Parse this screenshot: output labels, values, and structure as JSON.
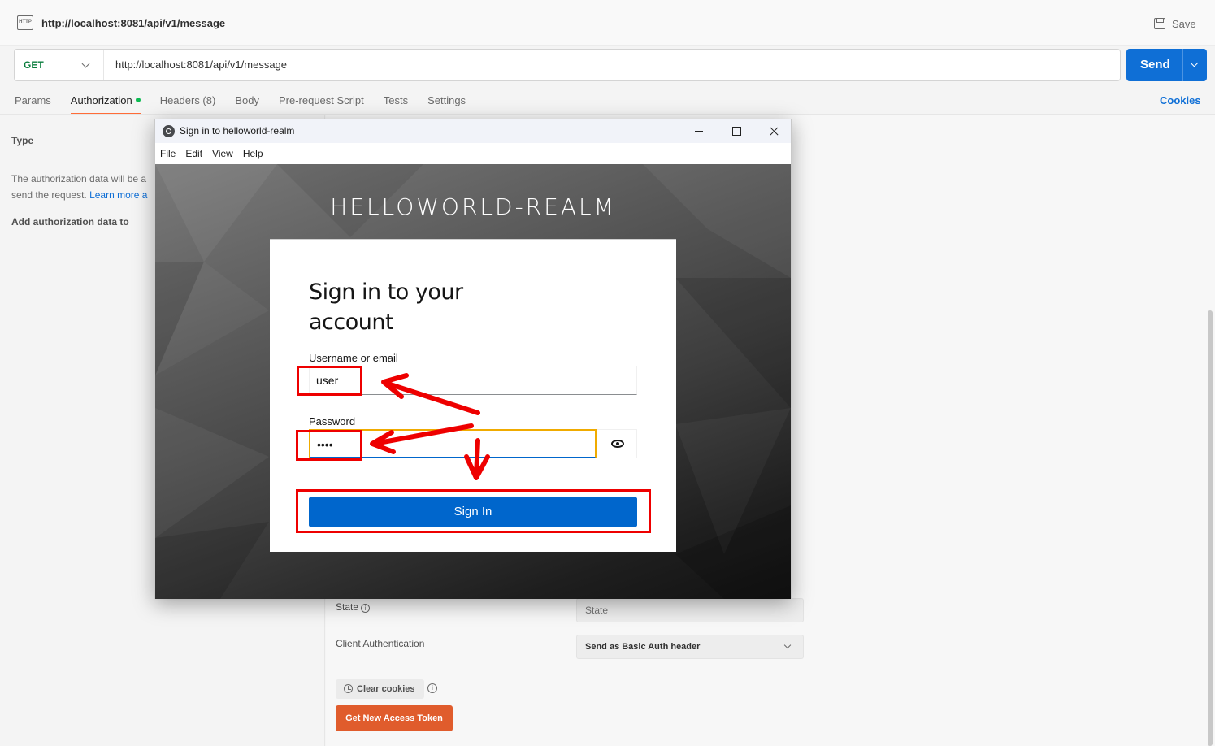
{
  "request_tab": {
    "title": "http://localhost:8081/api/v1/message",
    "save_label": "Save"
  },
  "url_bar": {
    "method": "GET",
    "url": "http://localhost:8081/api/v1/message",
    "send_label": "Send"
  },
  "request_tabs": [
    "Params",
    "Authorization",
    "Headers (8)",
    "Body",
    "Pre-request Script",
    "Tests",
    "Settings"
  ],
  "cookies_label": "Cookies",
  "left_panel": {
    "type_label": "Type",
    "desc_line1": "The authorization data will be a",
    "desc_line2": "send the request.",
    "desc_link": "Learn more a",
    "add_auth_label": "Add authorization data to"
  },
  "right_panel": {
    "state_label": "State",
    "state_placeholder": "State",
    "client_auth_label": "Client Authentication",
    "client_auth_value": "Send as Basic Auth header",
    "clear_cookies_label": "Clear cookies",
    "get_token_label": "Get New Access Token"
  },
  "dialog": {
    "title": "Sign in to helloworld-realm",
    "menu": [
      "File",
      "Edit",
      "View",
      "Help"
    ],
    "realm_name": "HELLOWORLD-REALM",
    "card_title": "Sign in to your account",
    "username_label": "Username or email",
    "username_value": "user",
    "password_label": "Password",
    "password_value": "••••",
    "signin_label": "Sign In"
  },
  "colors": {
    "send": "#0f6fd6",
    "signin": "#0066cc",
    "annotation": "#ee0000",
    "get_token": "#e05c2c"
  }
}
